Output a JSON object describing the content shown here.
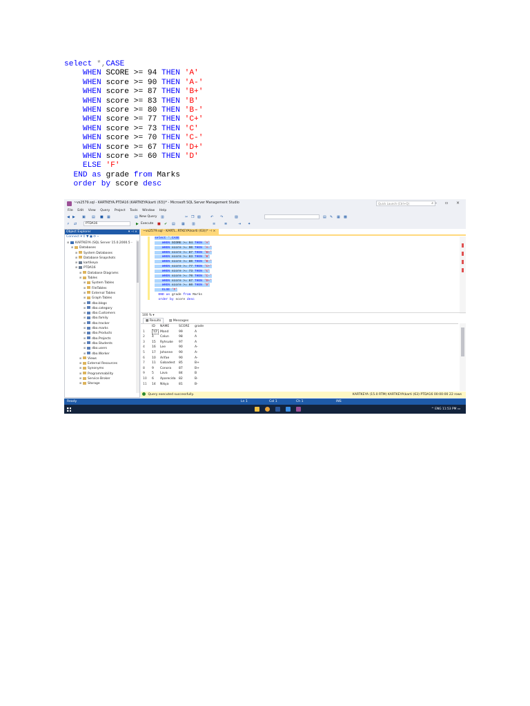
{
  "sql": {
    "line1_kw": "select",
    "line1_op": "*,",
    "line1_case": "CASE",
    "when_kw": "WHEN",
    "then_kw": "THEN",
    "op": ">=",
    "whens": [
      {
        "col": "SCORE",
        "num": "94",
        "grade": "'A'"
      },
      {
        "col": "score",
        "num": "90",
        "grade": "'A-'"
      },
      {
        "col": "score",
        "num": "87",
        "grade": "'B+'"
      },
      {
        "col": "score",
        "num": "83",
        "grade": "'B'"
      },
      {
        "col": "score",
        "num": "80",
        "grade": "'B-'"
      },
      {
        "col": "score",
        "num": "77",
        "grade": "'C+'"
      },
      {
        "col": "score",
        "num": "73",
        "grade": "'C'"
      },
      {
        "col": "score",
        "num": "70",
        "grade": "'C-'"
      },
      {
        "col": "score",
        "num": "67",
        "grade": "'D+'"
      },
      {
        "col": "score",
        "num": "60",
        "grade": "'D'"
      }
    ],
    "else_kw": "ELSE",
    "else_val": "'F'",
    "end_kw": "END",
    "as_kw": "as",
    "alias": "grade",
    "from_kw": "from",
    "table": "Marks",
    "order_kw": "order by",
    "order_col": "score",
    "desc_kw": "desc"
  },
  "ssms": {
    "title": "~vs2579.sql - KARTKEYA.PTDA16 (KARTKEYA\\karti (63))* - Microsoft SQL Server Management Studio",
    "quick_launch": "Quick Launch (Ctrl+Q)",
    "window_buttons": "– ▫ ×",
    "menu": [
      "File",
      "Edit",
      "View",
      "Query",
      "Project",
      "Tools",
      "Window",
      "Help"
    ],
    "toolbar": {
      "new_query": "New Query",
      "database": "PTDA16",
      "execute": "Execute"
    },
    "object_explorer": {
      "title": "Object Explorer",
      "connect": "Connect ▾",
      "nodes": [
        {
          "label": "KARTKEYA (SQL Server 15.0.2000.5 -",
          "depth": 0,
          "icon": "srv"
        },
        {
          "label": "Databases",
          "depth": 1,
          "icon": "folder"
        },
        {
          "label": "System Databases",
          "depth": 2,
          "icon": "folder"
        },
        {
          "label": "Database Snapshots",
          "depth": 2,
          "icon": "folder"
        },
        {
          "label": "kartikeya",
          "depth": 2,
          "icon": "db"
        },
        {
          "label": "PTDA16",
          "depth": 2,
          "icon": "db"
        },
        {
          "label": "Database Diagrams",
          "depth": 3,
          "icon": "folder"
        },
        {
          "label": "Tables",
          "depth": 3,
          "icon": "folder"
        },
        {
          "label": "System Tables",
          "depth": 4,
          "icon": "folder"
        },
        {
          "label": "FileTables",
          "depth": 4,
          "icon": "folder"
        },
        {
          "label": "External Tables",
          "depth": 4,
          "icon": "folder"
        },
        {
          "label": "Graph Tables",
          "depth": 4,
          "icon": "folder"
        },
        {
          "label": "dbo.blogs",
          "depth": 4,
          "icon": "tbl"
        },
        {
          "label": "dbo.category",
          "depth": 4,
          "icon": "tbl"
        },
        {
          "label": "dbo.Customers",
          "depth": 4,
          "icon": "tbl"
        },
        {
          "label": "dbo.family",
          "depth": 4,
          "icon": "tbl"
        },
        {
          "label": "dbo.tracker",
          "depth": 4,
          "icon": "tbl"
        },
        {
          "label": "dbo.marks",
          "depth": 4,
          "icon": "tbl"
        },
        {
          "label": "dbo.Products",
          "depth": 4,
          "icon": "tbl"
        },
        {
          "label": "dbo.Projects",
          "depth": 4,
          "icon": "tbl"
        },
        {
          "label": "dbo.Students",
          "depth": 4,
          "icon": "tbl"
        },
        {
          "label": "dbo.users",
          "depth": 4,
          "icon": "tbl"
        },
        {
          "label": "dbo.Worker",
          "depth": 4,
          "icon": "tbl"
        },
        {
          "label": "Views",
          "depth": 3,
          "icon": "folder"
        },
        {
          "label": "External Resources",
          "depth": 3,
          "icon": "folder"
        },
        {
          "label": "Synonyms",
          "depth": 3,
          "icon": "folder"
        },
        {
          "label": "Programmability",
          "depth": 3,
          "icon": "folder"
        },
        {
          "label": "Service Broker",
          "depth": 3,
          "icon": "folder"
        },
        {
          "label": "Storage",
          "depth": 3,
          "icon": "folder"
        }
      ]
    },
    "doc_tab": "~vs2579.sql - KARTL..RTKEYA\\karti (63))*",
    "zoom": "100 %",
    "result_tabs": [
      "Results",
      "Messages"
    ],
    "grid": {
      "headers": [
        "ID",
        "NAME",
        "SCORE",
        "grade"
      ],
      "rows": [
        [
          "1",
          "12",
          "Mand",
          "99",
          "A"
        ],
        [
          "2",
          "4",
          "Calun",
          "98",
          "A"
        ],
        [
          "3",
          "15",
          "Ryhsuke",
          "97",
          "A"
        ],
        [
          "4",
          "16",
          "Lee",
          "90",
          "A-"
        ],
        [
          "5",
          "17",
          "Johanne",
          "90",
          "A-"
        ],
        [
          "6",
          "10",
          "Arifae",
          "90",
          "A-"
        ],
        [
          "7",
          "11",
          "Gabadest",
          "85",
          "B+"
        ],
        [
          "8",
          "9",
          "Conora",
          "87",
          "B+"
        ],
        [
          "9",
          "5",
          "Lava",
          "84",
          "B"
        ],
        [
          "10",
          "6",
          "Aparecida",
          "82",
          "B-"
        ],
        [
          "11",
          "14",
          "Nikya",
          "81",
          "B-"
        ]
      ]
    },
    "query_status": "Query executed successfully.",
    "query_status_right": "KARTKEYA (15.0 RTM)   KARTKEYA\\karti (63)   PTDA16   00:00:00   22 rows",
    "statusbar": {
      "ready": "Ready",
      "ln": "Ln 1",
      "col": "Col 1",
      "ch": "Ch 1",
      "ins": "INS"
    },
    "taskbar": {
      "tray": "^  ENG   11:53 PM"
    }
  },
  "colors": {
    "keyword": "#0000ff",
    "string": "#ff0000",
    "operator": "#808080",
    "accent": "#1e5aa8"
  }
}
